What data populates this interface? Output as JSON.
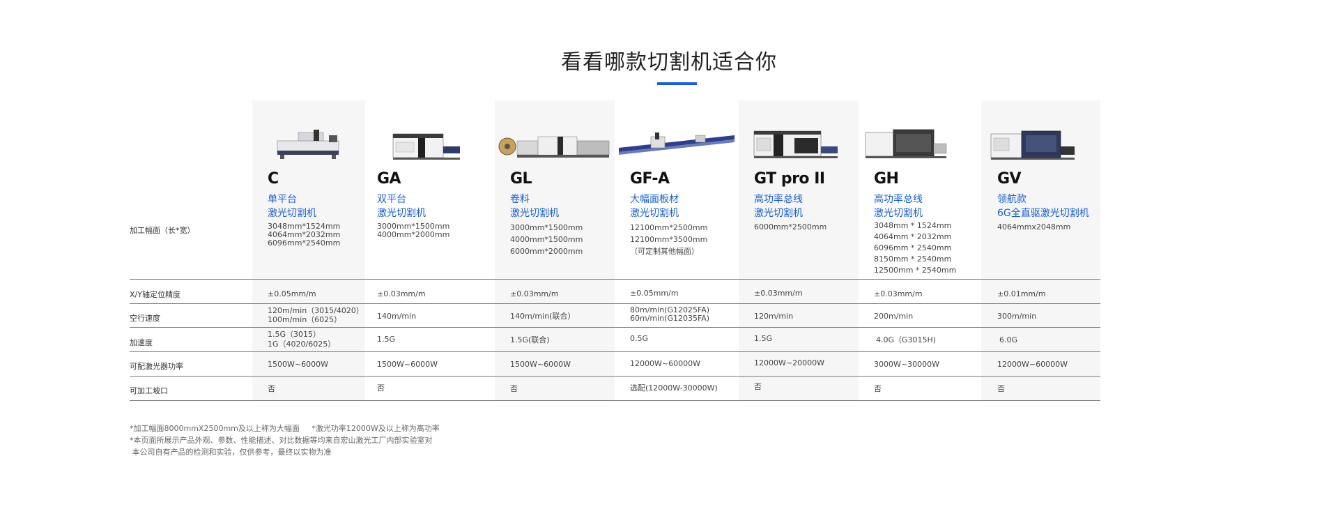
{
  "page_title": "看看哪款切割机适合你",
  "row_labels": [
    "加工幅面（长*宽）",
    "X/Y轴定位精度",
    "空行速度",
    "加速度",
    "可配激光器功率",
    "可加工坡口"
  ],
  "products": [
    {
      "model": "C",
      "subtitle_line1": "单平台",
      "subtitle_line2": "激光切割机",
      "size": [
        "3048mm*1524mm",
        "4064mm*2032mm",
        "6096mm*2540mm"
      ],
      "accuracy": "±0.05mm/m",
      "speed": [
        "120m/min（3015/4020）",
        "100m/min（6025）"
      ],
      "acceleration": [
        "1.5G（3015）",
        "1G（4020/6025）"
      ],
      "power": "1500W~6000W",
      "bevel": "否"
    },
    {
      "model": "GA",
      "subtitle_line1": "双平台",
      "subtitle_line2": "激光切割机",
      "size": [
        "3000mm*1500mm",
        "4000mm*2000mm"
      ],
      "accuracy": "±0.03mm/m",
      "speed": [
        "140m/min"
      ],
      "acceleration": [
        "1.5G"
      ],
      "power": "1500W~6000W",
      "bevel": "否"
    },
    {
      "model": "GL",
      "subtitle_line1": "卷料",
      "subtitle_line2": "激光切割机",
      "size": [
        "3000mm*1500mm",
        "4000mm*1500mm",
        "6000mm*2000mm"
      ],
      "accuracy": "±0.03mm/m",
      "speed": [
        "140m/min(联合）"
      ],
      "acceleration": [
        "1.5G(联合)"
      ],
      "power": "1500W~6000W",
      "bevel": "否"
    },
    {
      "model": "GF-A",
      "subtitle_line1": "大幅面板材",
      "subtitle_line2": "激光切割机",
      "size": [
        "12100mm*2500mm",
        "12100mm*3500mm",
        "（可定制其他幅面）"
      ],
      "accuracy": "±0.05mm/m",
      "speed": [
        "80m/min(G12025FA)",
        "60m/min(G12035FA)"
      ],
      "acceleration": [
        "0.5G"
      ],
      "power": "12000W~60000W",
      "bevel": "选配(12000W-30000W)"
    },
    {
      "model": "GT pro II",
      "subtitle_line1": "高功率总线",
      "subtitle_line2": "激光切割机",
      "size": [
        "6000mm*2500mm"
      ],
      "accuracy": "±0.03mm/m",
      "speed": [
        "120m/min"
      ],
      "acceleration": [
        "1.5G"
      ],
      "power": "12000W~20000W",
      "bevel": "否"
    },
    {
      "model": "GH",
      "subtitle_line1": "高功率总线",
      "subtitle_line2": "激光切割机",
      "size": [
        "3048mm * 1524mm",
        "4064mm * 2032mm",
        "6096mm * 2540mm",
        "8150mm * 2540mm",
        "12500mm * 2540mm"
      ],
      "accuracy": "±0.03mm/m",
      "speed": [
        "200m/min"
      ],
      "acceleration": [
        "4.0G（G3015H)"
      ],
      "power": "3000W~30000W",
      "bevel": "否"
    },
    {
      "model": "GV",
      "subtitle_line1": "领航款",
      "subtitle_line2": "6G全直驱激光切割机",
      "size": [
        "4064mmx2048mm"
      ],
      "accuracy": "±0.01mm/m",
      "speed": [
        "300m/min"
      ],
      "acceleration": [
        "6.0G"
      ],
      "power": "12000W~60000W",
      "bevel": "否"
    }
  ],
  "notes": [
    "*加工幅面8000mmX2500mm及以上称为大幅面     *激光功率12000W及以上称为高功率",
    "*本页面所展示产品外观、参数、性能描述、对比数据等均来自宏山激光工厂内部实验室对",
    " 本公司自有产品的检测和实验，仅供参考，最终以实物为准"
  ],
  "colors": {
    "accent": "#1a5dd6",
    "column_shade": "#f6f6f6",
    "rule": "#7a7a7a"
  }
}
